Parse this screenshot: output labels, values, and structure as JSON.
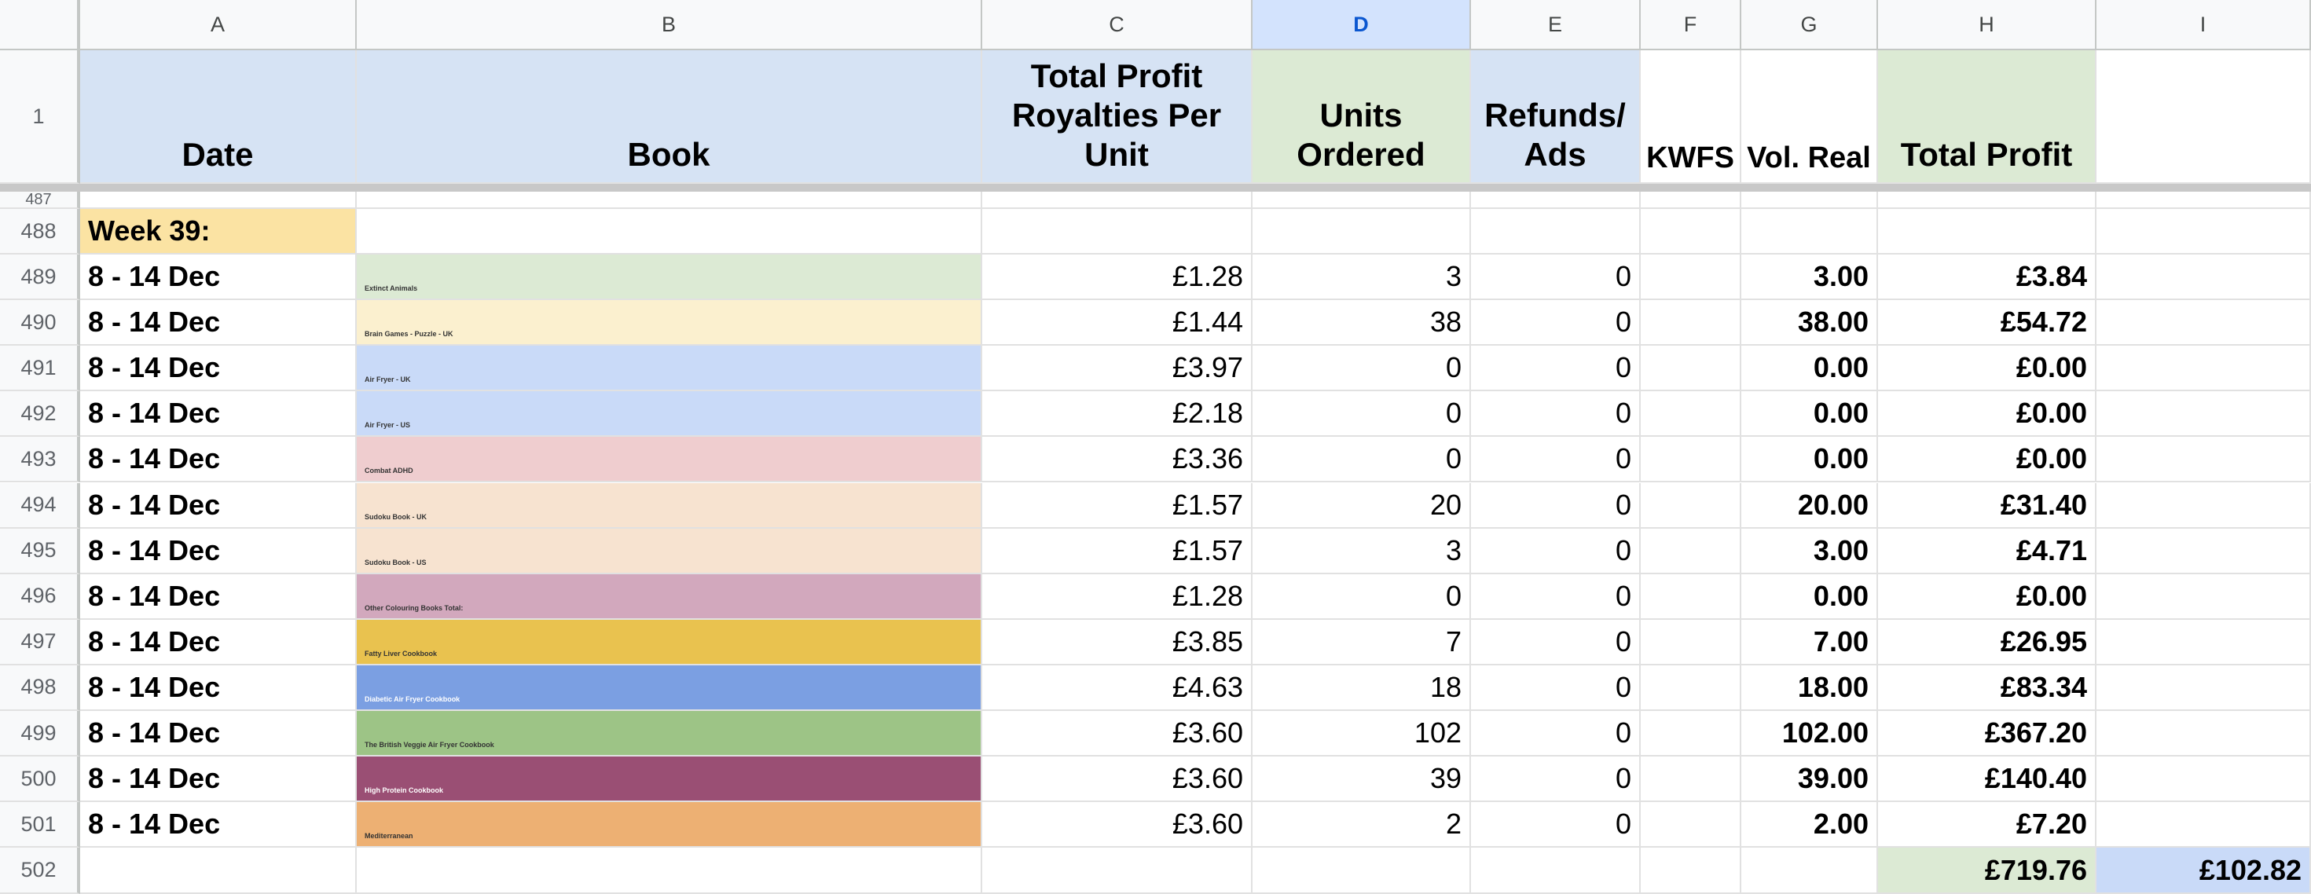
{
  "columns": [
    "A",
    "B",
    "C",
    "D",
    "E",
    "F",
    "G",
    "H",
    "I"
  ],
  "headers": {
    "row_number": "1",
    "date": "Date",
    "book": "Book",
    "royalties": "Total Profit Royalties Per Unit",
    "units": "Units Ordered",
    "refunds": "Refunds/ Ads",
    "kwfs": "KWFS",
    "vol_real": "Vol. Real",
    "total_profit": "Total Profit"
  },
  "hidden_row_number": "487",
  "week_row": {
    "row_number": "488",
    "label": "Week 39:"
  },
  "rows": [
    {
      "n": "489",
      "date": "8 - 14 Dec",
      "book": "Extinct Animals",
      "color": "#dcead4",
      "royalty": "£1.28",
      "units": "3",
      "refunds": "0",
      "vol": "3.00",
      "profit": "£3.84"
    },
    {
      "n": "490",
      "date": "8 - 14 Dec",
      "book": "Brain Games - Puzzle - UK",
      "color": "#fbf0cf",
      "royalty": "£1.44",
      "units": "38",
      "refunds": "0",
      "vol": "38.00",
      "profit": "£54.72"
    },
    {
      "n": "491",
      "date": "8 - 14 Dec",
      "book": "Air Fryer - UK",
      "color": "#c9daf8",
      "royalty": "£3.97",
      "units": "0",
      "refunds": "0",
      "vol": "0.00",
      "profit": "£0.00"
    },
    {
      "n": "492",
      "date": "8 - 14 Dec",
      "book": "Air Fryer - US",
      "color": "#c9daf8",
      "royalty": "£2.18",
      "units": "0",
      "refunds": "0",
      "vol": "0.00",
      "profit": "£0.00"
    },
    {
      "n": "493",
      "date": "8 - 14 Dec",
      "book": "Combat ADHD",
      "color": "#efcdcf",
      "royalty": "£3.36",
      "units": "0",
      "refunds": "0",
      "vol": "0.00",
      "profit": "£0.00"
    },
    {
      "n": "494",
      "date": "8 - 14 Dec",
      "book": "Sudoku Book - UK",
      "color": "#f7e3d0",
      "royalty": "£1.57",
      "units": "20",
      "refunds": "0",
      "vol": "20.00",
      "profit": "£31.40"
    },
    {
      "n": "495",
      "date": "8 - 14 Dec",
      "book": "Sudoku Book - US",
      "color": "#f7e3d0",
      "royalty": "£1.57",
      "units": "3",
      "refunds": "0",
      "vol": "3.00",
      "profit": "£4.71"
    },
    {
      "n": "496",
      "date": "8 - 14 Dec",
      "book": "Other Colouring Books Total:",
      "color": "#d2a8bd",
      "royalty": "£1.28",
      "units": "0",
      "refunds": "0",
      "vol": "0.00",
      "profit": "£0.00"
    },
    {
      "n": "497",
      "date": "8 - 14 Dec",
      "book": "Fatty Liver Cookbook",
      "color": "#e9c24f",
      "royalty": "£3.85",
      "units": "7",
      "refunds": "0",
      "vol": "7.00",
      "profit": "£26.95"
    },
    {
      "n": "498",
      "date": "8 - 14 Dec",
      "book": "Diabetic Air Fryer Cookbook",
      "color": "#7b9fe2",
      "royalty": "£4.63",
      "units": "18",
      "refunds": "0",
      "vol": "18.00",
      "profit": "£83.34",
      "light": true
    },
    {
      "n": "499",
      "date": "8 - 14 Dec",
      "book": "The British Veggie Air Fryer Cookbook",
      "color": "#9dc486",
      "royalty": "£3.60",
      "units": "102",
      "refunds": "0",
      "vol": "102.00",
      "profit": "£367.20"
    },
    {
      "n": "500",
      "date": "8 - 14 Dec",
      "book": "High Protein Cookbook",
      "color": "#9a4f74",
      "royalty": "£3.60",
      "units": "39",
      "refunds": "0",
      "vol": "39.00",
      "profit": "£140.40",
      "light": true
    },
    {
      "n": "501",
      "date": "8 - 14 Dec",
      "book": "Mediterranean",
      "color": "#edb073",
      "royalty": "£3.60",
      "units": "2",
      "refunds": "0",
      "vol": "2.00",
      "profit": "£7.20"
    }
  ],
  "total_row": {
    "n": "502",
    "total_profit": "£719.76",
    "extra": "£102.82"
  },
  "colors": {
    "header_blue": "#d6e3f4",
    "header_green": "#dcead4",
    "week_label": "#fbe3a3",
    "total_green": "#dcead4",
    "total_blue": "#c9daf8",
    "selected_column": "#d3e3fd"
  }
}
